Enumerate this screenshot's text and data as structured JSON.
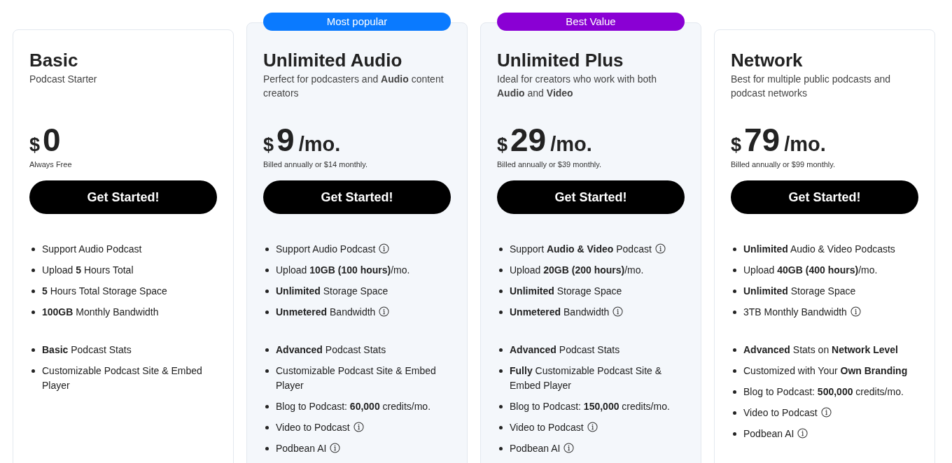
{
  "plans": [
    {
      "name": "Basic",
      "subtitle": "Podcast Starter",
      "highlighted": false,
      "currency": "$",
      "price": "0",
      "billing": "Always Free",
      "button": "Get Started!",
      "feature_groups": [
        [
          {
            "text": "Support Audio Podcast",
            "info": false
          },
          {
            "text": "Upload **5** Hours Total",
            "info": false
          },
          {
            "text": "**5** Hours Total Storage Space",
            "info": false
          },
          {
            "text": "**100GB** Monthly Bandwidth",
            "info": false
          }
        ],
        [
          {
            "text": "**Basic** Podcast Stats",
            "info": false
          },
          {
            "text": "Customizable Podcast Site & Embed Player",
            "info": false
          }
        ]
      ]
    },
    {
      "name": "Unlimited Audio",
      "subtitle": "Perfect for podcasters and **Audio** content creators",
      "highlighted": true,
      "badge": {
        "text": "Most popular",
        "color": "#0a7aff"
      },
      "currency": "$",
      "price": "9",
      "period": "/mo.",
      "billing": "Billed annually or $14 monthly.",
      "button": "Get Started!",
      "feature_groups": [
        [
          {
            "text": "Support Audio Podcast",
            "info": true
          },
          {
            "text": "Upload **10GB (100 hours)**/mo.",
            "info": false
          },
          {
            "text": "**Unlimited** Storage Space",
            "info": false
          },
          {
            "text": "**Unmetered** Bandwidth",
            "info": true
          }
        ],
        [
          {
            "text": "**Advanced** Podcast Stats",
            "info": false
          },
          {
            "text": "Customizable Podcast Site & Embed Player",
            "info": false
          },
          {
            "text": "Blog to Podcast: **60,000** credits/mo.",
            "info": false
          },
          {
            "text": "Video to Podcast",
            "info": true
          },
          {
            "text": "Podbean AI",
            "info": true
          }
        ]
      ]
    },
    {
      "name": "Unlimited Plus",
      "subtitle": "Ideal for creators who work with both **Audio** and **Video**",
      "highlighted": true,
      "badge": {
        "text": "Best Value",
        "color": "#8a00d4"
      },
      "currency": "$",
      "price": "29",
      "period": "/mo.",
      "billing": "Billed annually or $39 monthly.",
      "button": "Get Started!",
      "feature_groups": [
        [
          {
            "text": "Support **Audio & Video** Podcast",
            "info": true
          },
          {
            "text": "Upload **20GB (200 hours)**/mo.",
            "info": false
          },
          {
            "text": "**Unlimited** Storage Space",
            "info": false
          },
          {
            "text": "**Unmetered** Bandwidth",
            "info": true
          }
        ],
        [
          {
            "text": "**Advanced** Podcast Stats",
            "info": false
          },
          {
            "text": "**Fully** Customizable Podcast Site & Embed Player",
            "info": false
          },
          {
            "text": "Blog to Podcast: **150,000** credits/mo.",
            "info": false
          },
          {
            "text": "Video to Podcast",
            "info": true
          },
          {
            "text": "Podbean AI",
            "info": true
          }
        ]
      ]
    },
    {
      "name": "Network",
      "subtitle": "Best for multiple public podcasts and podcast networks",
      "highlighted": false,
      "currency": "$",
      "price": "79",
      "period": "/mo.",
      "billing": "Billed annually or $99 monthly.",
      "button": "Get Started!",
      "feature_groups": [
        [
          {
            "text": "**Unlimited** Audio & Video Podcasts",
            "info": false
          },
          {
            "text": "Upload **40GB (400 hours)**/mo.",
            "info": false
          },
          {
            "text": "**Unlimited** Storage Space",
            "info": false
          },
          {
            "text": "3TB Monthly Bandwidth",
            "info": true
          }
        ],
        [
          {
            "text": "**Advanced** Stats on **Network Level**",
            "info": false
          },
          {
            "text": "Customized with Your **Own Branding**",
            "info": false
          },
          {
            "text": "Blog to Podcast: **500,000** credits/mo.",
            "info": false
          },
          {
            "text": "Video to Podcast",
            "info": true
          },
          {
            "text": "Podbean AI",
            "info": true
          }
        ]
      ]
    }
  ]
}
